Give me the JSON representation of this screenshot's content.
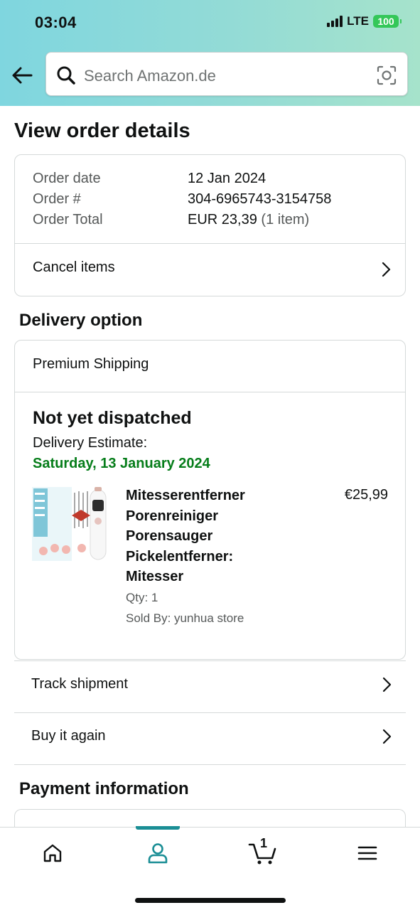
{
  "status_bar": {
    "time": "03:04",
    "network": "LTE",
    "battery": "100"
  },
  "header": {
    "search_placeholder": "Search Amazon.de"
  },
  "page_title": "View order details",
  "order_summary": {
    "date_label": "Order date",
    "date_value": "12 Jan 2024",
    "number_label": "Order #",
    "number_value": "304-6965743-3154758",
    "total_label": "Order Total",
    "total_value": "EUR 23,39",
    "total_items": "(1 item)",
    "cancel_label": "Cancel items"
  },
  "delivery": {
    "section_title": "Delivery option",
    "shipping_method": "Premium Shipping",
    "status": "Not yet dispatched",
    "estimate_label": "Delivery Estimate:",
    "estimate_date": "Saturday, 13 January 2024",
    "item": {
      "title_lines": [
        "Mitesserentferner",
        "Porenreiniger",
        "Porensauger",
        "Pickelentferner:",
        "Mitesser"
      ],
      "price": "€25,99",
      "qty": "Qty: 1",
      "sold_by": "Sold By: yunhua store"
    }
  },
  "actions": {
    "track_label": "Track shipment",
    "buy_again_label": "Buy it again"
  },
  "payment": {
    "section_title": "Payment information"
  },
  "bottom_nav": {
    "cart_count": "1",
    "active_tab": "account",
    "accent_color": "#1a8e95"
  },
  "colors": {
    "estimate_green": "#067d1a",
    "header_gradient_start": "#7fd6df",
    "header_gradient_end": "#a6e3cb"
  }
}
